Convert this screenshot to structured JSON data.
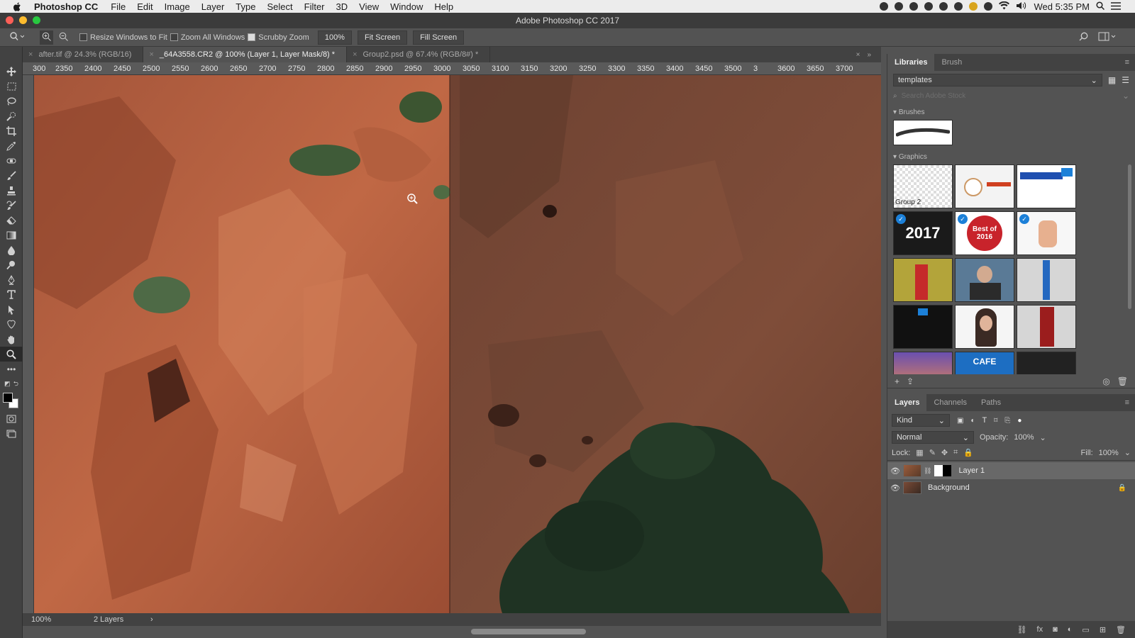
{
  "menubar": {
    "app_name": "Photoshop CC",
    "menus": [
      "File",
      "Edit",
      "Image",
      "Layer",
      "Type",
      "Select",
      "Filter",
      "3D",
      "View",
      "Window",
      "Help"
    ],
    "clock": "Wed 5:35 PM"
  },
  "window": {
    "title": "Adobe Photoshop CC 2017"
  },
  "options_bar": {
    "resize_windows_label": "Resize Windows to Fit",
    "zoom_all_label": "Zoom All Windows",
    "scrubby_zoom_label": "Scrubby Zoom",
    "zoom_value": "100%",
    "fit_screen_label": "Fit Screen",
    "fill_screen_label": "Fill Screen",
    "resize_windows_checked": false,
    "zoom_all_checked": false,
    "scrubby_zoom_checked": true
  },
  "doc_tabs": [
    {
      "label": "after.tif @ 24.3% (RGB/16)",
      "active": false
    },
    {
      "label": "_64A3558.CR2 @ 100% (Layer 1, Layer Mask/8) *",
      "active": true
    },
    {
      "label": "Group2.psd @ 67.4% (RGB/8#) *",
      "active": false
    }
  ],
  "ruler": {
    "ticks": [
      "300",
      "2350",
      "2400",
      "2450",
      "2500",
      "2550",
      "2600",
      "2650",
      "2700",
      "2750",
      "2800",
      "2850",
      "2900",
      "2950",
      "3000",
      "3050",
      "3100",
      "3150",
      "3200",
      "3250",
      "3300",
      "3350",
      "3400",
      "3450",
      "3500",
      "3",
      "3600",
      "3650",
      "3700"
    ]
  },
  "status": {
    "zoom": "100%",
    "info": "2 Layers"
  },
  "libraries": {
    "tab_libraries": "Libraries",
    "tab_brush": "Brush",
    "library_name": "templates",
    "search_placeholder": "Search Adobe Stock",
    "brushes_label": "Brushes",
    "graphics_label": "Graphics",
    "group_label": "Group 2",
    "thumb_2017": "2017",
    "thumb_best": "Best of 2016",
    "thumb_cafe": "CAFE"
  },
  "layers_panel": {
    "tabs": [
      "Layers",
      "Channels",
      "Paths"
    ],
    "kind_label": "Kind",
    "blend_mode": "Normal",
    "opacity_label": "Opacity:",
    "opacity_value": "100%",
    "lock_label": "Lock:",
    "fill_label": "Fill:",
    "fill_value": "100%",
    "layers": [
      {
        "name": "Layer 1",
        "selected": true
      },
      {
        "name": "Background",
        "selected": false
      }
    ]
  },
  "colors": {
    "accent": "#1c80d8",
    "rock_left": "#b86040",
    "rock_right": "#7a4a36",
    "tree": "#1f3323"
  }
}
